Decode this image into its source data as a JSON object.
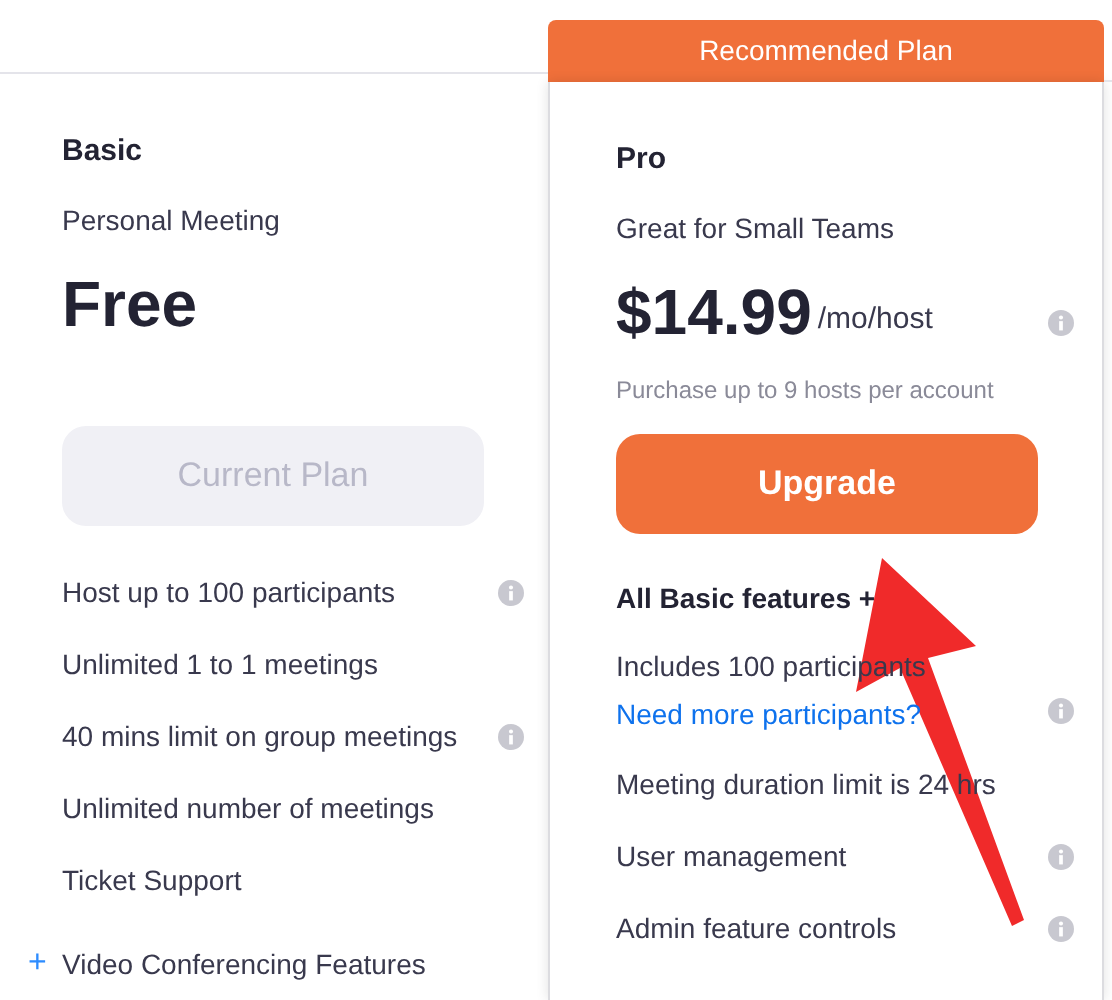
{
  "plans": [
    {
      "name": "Basic",
      "tagline": "Personal Meeting",
      "price": "Free",
      "button": {
        "kind": "current",
        "label": "Current Plan",
        "disabled": true
      },
      "features": [
        {
          "kind": "item",
          "text": "Host up to 100 participants",
          "info": true
        },
        {
          "kind": "item",
          "text": "Unlimited 1 to 1 meetings",
          "info": false
        },
        {
          "kind": "item",
          "text": "40 mins limit on group meetings",
          "info": true
        },
        {
          "kind": "item",
          "text": "Unlimited number of meetings",
          "info": false
        },
        {
          "kind": "item",
          "text": "Ticket Support",
          "info": false
        },
        {
          "kind": "expander",
          "text": "Video Conferencing Features",
          "symbol": "+",
          "info": false
        }
      ]
    },
    {
      "name": "Pro",
      "banner": "Recommended Plan",
      "tagline": "Great for Small Teams",
      "price": "$14.99",
      "unit": "/mo/host",
      "price_info": true,
      "note": "Purchase up to 9 hosts per account",
      "button": {
        "kind": "upgrade",
        "label": "Upgrade",
        "disabled": false
      },
      "features": [
        {
          "kind": "heading",
          "text": "All Basic features +",
          "info": false
        },
        {
          "kind": "item",
          "text": "Includes 100 participants",
          "link": "Need more participants?",
          "info": true
        },
        {
          "kind": "item",
          "text": "Meeting duration limit is 24 hrs",
          "info": false
        },
        {
          "kind": "item",
          "text": "User management",
          "info": true
        },
        {
          "kind": "item",
          "text": "Admin feature controls",
          "info": true
        }
      ]
    }
  ]
}
